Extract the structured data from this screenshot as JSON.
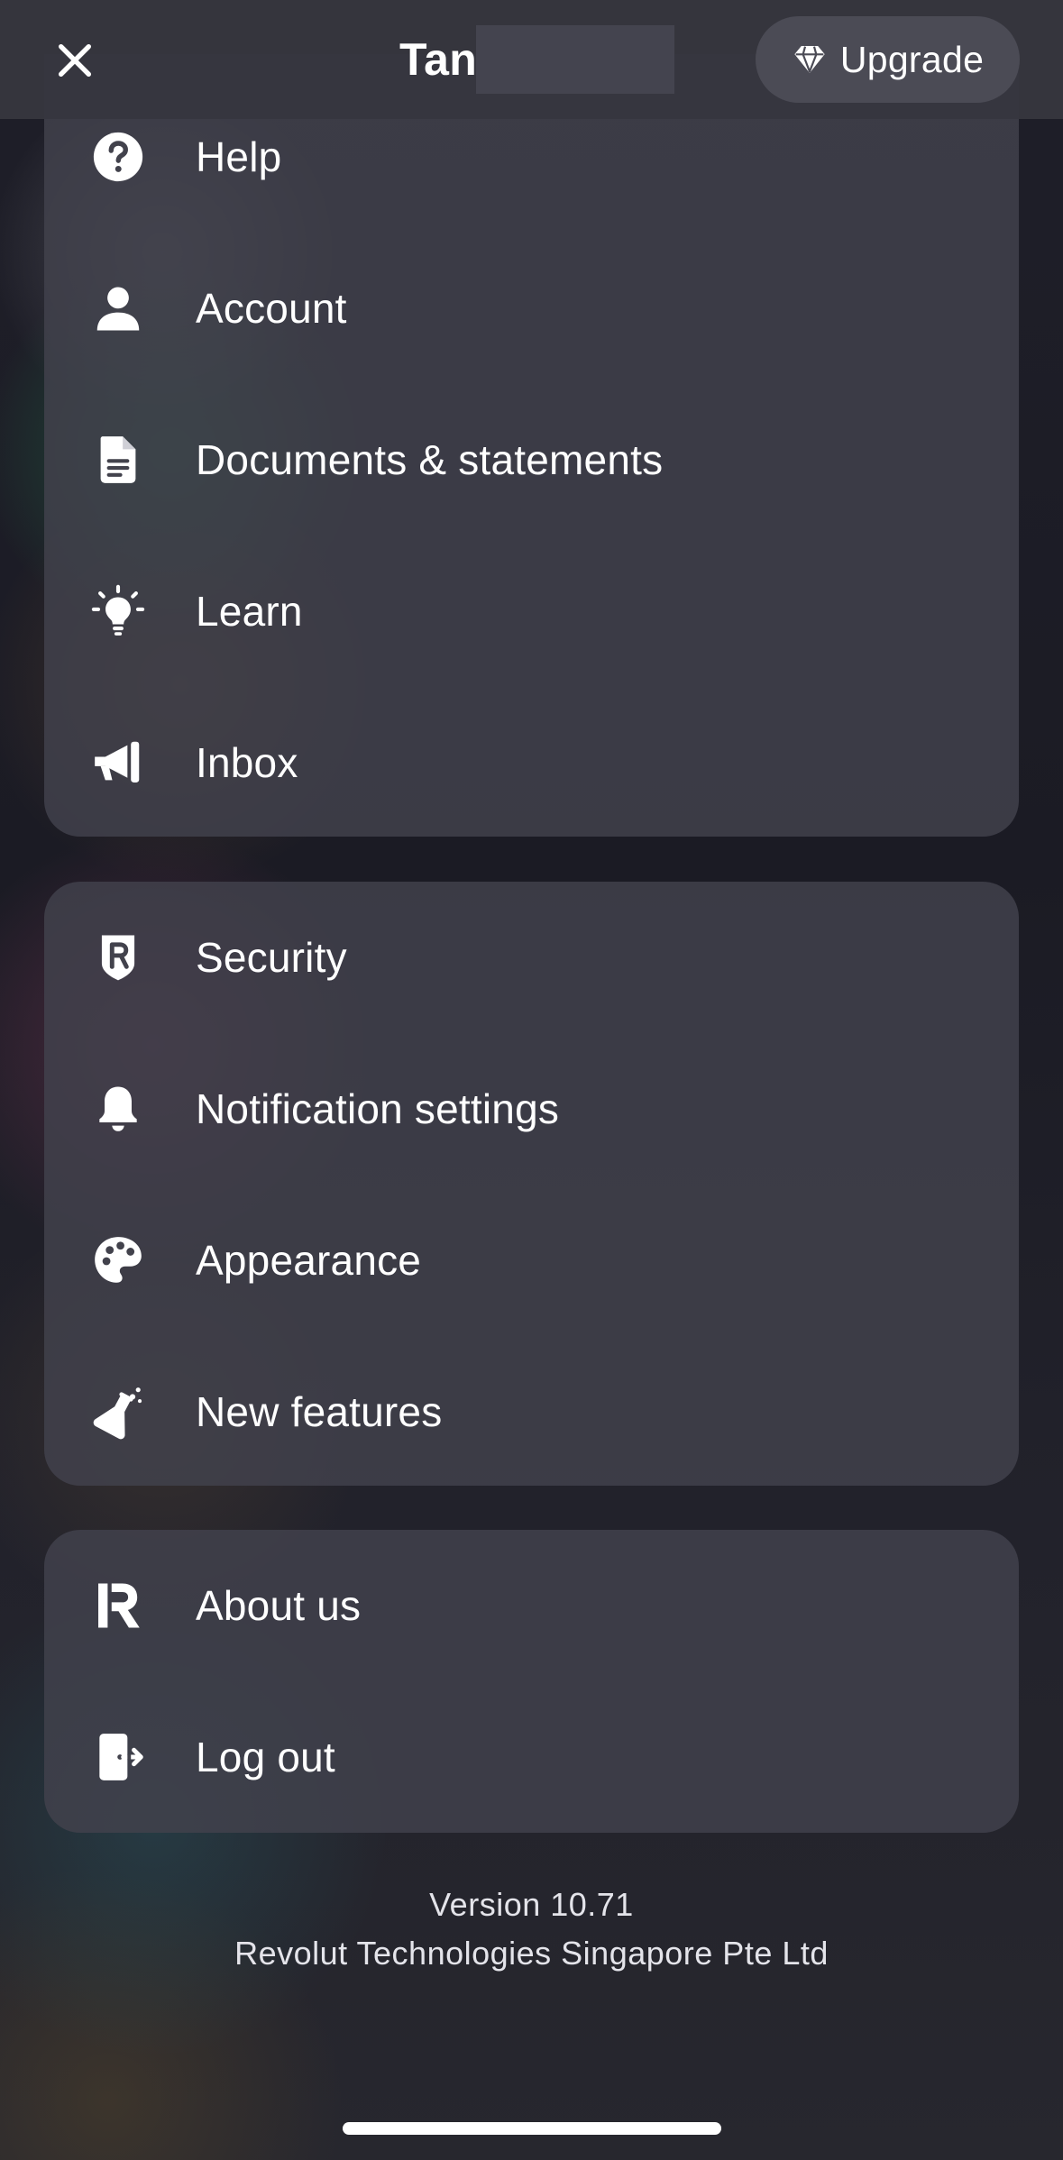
{
  "header": {
    "close_icon": "close-icon",
    "title": "Tan",
    "upgrade_label": "Upgrade",
    "upgrade_icon": "diamond-icon"
  },
  "sections": [
    {
      "items": [
        {
          "label": "Help",
          "icon": "help-icon"
        },
        {
          "label": "Account",
          "icon": "account-icon"
        },
        {
          "label": "Documents & statements",
          "icon": "document-icon"
        },
        {
          "label": "Learn",
          "icon": "lightbulb-icon"
        },
        {
          "label": "Inbox",
          "icon": "megaphone-icon"
        }
      ]
    },
    {
      "items": [
        {
          "label": "Security",
          "icon": "shield-icon"
        },
        {
          "label": "Notification settings",
          "icon": "bell-icon"
        },
        {
          "label": "Appearance",
          "icon": "palette-icon"
        },
        {
          "label": "New features",
          "icon": "flask-icon"
        }
      ]
    },
    {
      "items": [
        {
          "label": "About us",
          "icon": "revolut-logo-icon"
        },
        {
          "label": "Log out",
          "icon": "logout-icon"
        }
      ]
    }
  ],
  "footer": {
    "version": "Version 10.71",
    "company": "Revolut Technologies Singapore Pte Ltd"
  },
  "colors": {
    "background": "#1b1b24",
    "card": "#42424c",
    "topbar": "#36363e",
    "upgrade_button": "#4b4b55",
    "text": "#ffffff"
  }
}
